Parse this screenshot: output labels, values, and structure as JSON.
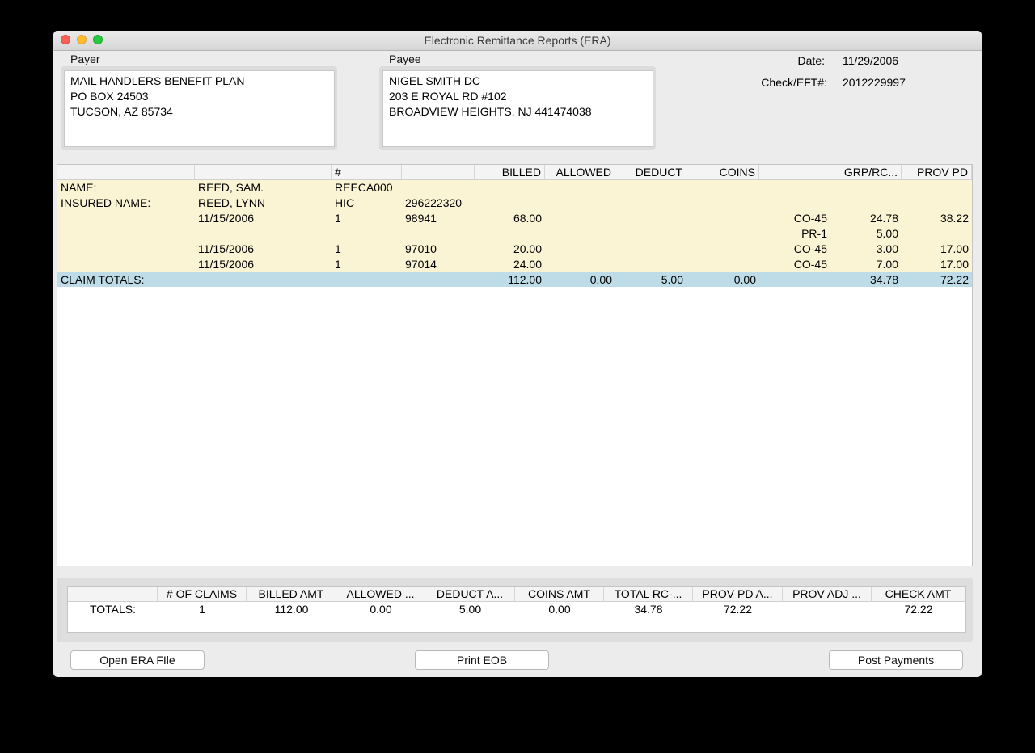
{
  "window": {
    "title": "Electronic Remittance Reports (ERA)"
  },
  "payer": {
    "label": "Payer",
    "lines": [
      "MAIL HANDLERS BENEFIT PLAN",
      "PO BOX 24503",
      "TUCSON, AZ 85734"
    ]
  },
  "payee": {
    "label": "Payee",
    "lines": [
      "NIGEL SMITH DC",
      "203 E ROYAL RD #102",
      "BROADVIEW HEIGHTS, NJ 441474038"
    ]
  },
  "info": {
    "date_label": "Date:",
    "date_value": "11/29/2006",
    "check_label": "Check/EFT#:",
    "check_value": "2012229997"
  },
  "claim_table": {
    "headers": [
      "",
      "",
      "#",
      "",
      "BILLED",
      "ALLOWED",
      "DEDUCT",
      "COINS",
      "",
      "GRP/RC...",
      "PROV PD"
    ],
    "rows": [
      [
        "NAME:",
        "REED, SAM.",
        "REECA000",
        "",
        "",
        "",
        "",
        "",
        "",
        "",
        ""
      ],
      [
        "INSURED NAME:",
        "REED, LYNN",
        "HIC",
        "296222320",
        "",
        "",
        "",
        "",
        "",
        "",
        ""
      ],
      [
        "",
        "11/15/2006",
        "1",
        "98941",
        "68.00",
        "",
        "",
        "",
        "CO-45",
        "24.78",
        "38.22"
      ],
      [
        "",
        "",
        "",
        "",
        "",
        "",
        "",
        "",
        "PR-1",
        "5.00",
        ""
      ],
      [
        "",
        "11/15/2006",
        "1",
        "97010",
        "20.00",
        "",
        "",
        "",
        "CO-45",
        "3.00",
        "17.00"
      ],
      [
        "",
        "11/15/2006",
        "1",
        "97014",
        "24.00",
        "",
        "",
        "",
        "CO-45",
        "7.00",
        "17.00"
      ]
    ],
    "total_row": [
      "CLAIM TOTALS:",
      "",
      "",
      "",
      "112.00",
      "0.00",
      "5.00",
      "0.00",
      "",
      "34.78",
      "72.22"
    ]
  },
  "totals_table": {
    "headers": [
      "",
      "# OF CLAIMS",
      "BILLED AMT",
      "ALLOWED ...",
      "DEDUCT A...",
      "COINS AMT",
      "TOTAL RC-...",
      "PROV PD A...",
      "PROV ADJ ...",
      "CHECK AMT"
    ],
    "row": [
      "TOTALS:",
      "1",
      "112.00",
      "0.00",
      "5.00",
      "0.00",
      "34.78",
      "72.22",
      "",
      "72.22"
    ]
  },
  "buttons": {
    "open_era": "Open ERA FIle",
    "print_eob": "Print EOB",
    "post_payments": "Post Payments"
  }
}
